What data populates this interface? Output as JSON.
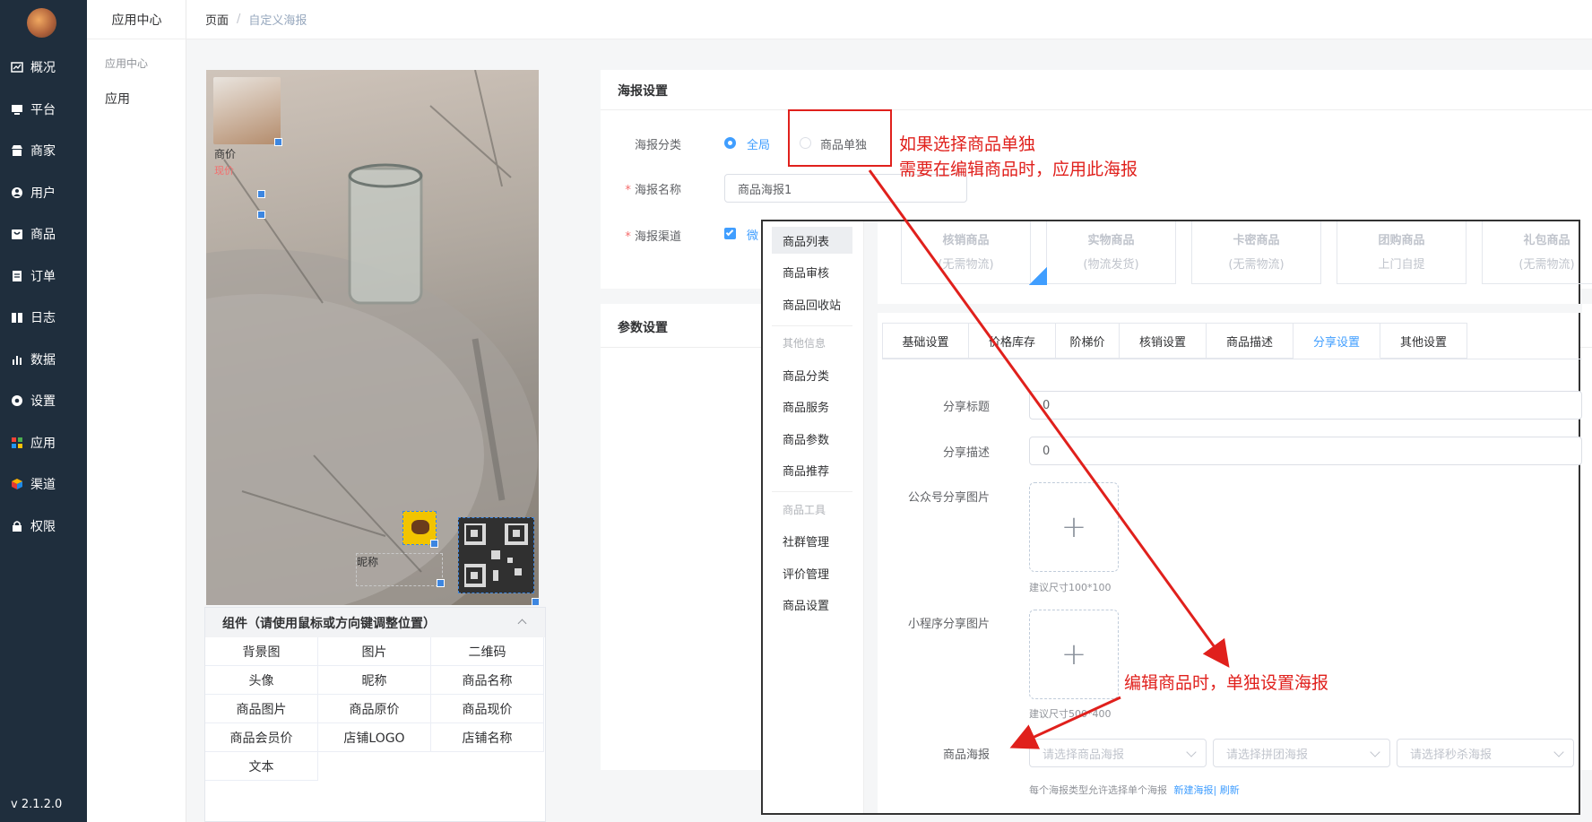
{
  "app": {
    "version": "v 2.1.2.0"
  },
  "sidebar": {
    "items": [
      {
        "label": "概况",
        "icon": "chart-icon"
      },
      {
        "label": "平台",
        "icon": "monitor-icon"
      },
      {
        "label": "商家",
        "icon": "store-icon"
      },
      {
        "label": "用户",
        "icon": "user-icon"
      },
      {
        "label": "商品",
        "icon": "goods-icon"
      },
      {
        "label": "订单",
        "icon": "order-icon"
      },
      {
        "label": "日志",
        "icon": "log-icon"
      },
      {
        "label": "数据",
        "icon": "bar-chart-icon"
      },
      {
        "label": "设置",
        "icon": "gear-icon"
      },
      {
        "label": "应用",
        "icon": "apps-icon"
      },
      {
        "label": "渠道",
        "icon": "cube-icon"
      },
      {
        "label": "权限",
        "icon": "lock-icon"
      }
    ]
  },
  "subsidebar": {
    "title": "应用中心",
    "group": "应用中心",
    "item": "应用"
  },
  "breadcrumb": {
    "root": "页面",
    "sep": "/",
    "current": "自定义海报"
  },
  "canvas": {
    "price_label": "商价",
    "vip_label": "现价",
    "nickname": "昵称"
  },
  "components": {
    "title": "组件（请使用鼠标或方向键调整位置）",
    "items": [
      "背景图",
      "图片",
      "二维码",
      "头像",
      "昵称",
      "商品名称",
      "商品图片",
      "商品原价",
      "商品现价",
      "商品会员价",
      "店铺LOGO",
      "店铺名称",
      "文本"
    ]
  },
  "poster": {
    "title": "海报设置",
    "category_label": "海报分类",
    "category_options": [
      "全局",
      "商品单独"
    ],
    "category_selected": "全局",
    "name_label": "海报名称",
    "name_value": "商品海报1",
    "channel_label": "海报渠道",
    "channel_text": "微"
  },
  "params": {
    "title": "参数设置"
  },
  "annotations": {
    "note1_line1": "如果选择商品单独",
    "note1_line2": "需要在编辑商品时，应用此海报",
    "note2": "编辑商品时，单独设置海报"
  },
  "goods_editor": {
    "menu": [
      {
        "label": "商品列表",
        "active": true
      },
      {
        "label": "商品审核"
      },
      {
        "label": "商品回收站"
      },
      {
        "label": "其他信息",
        "group": true
      },
      {
        "label": "商品分类"
      },
      {
        "label": "商品服务"
      },
      {
        "label": "商品参数"
      },
      {
        "label": "商品推荐"
      },
      {
        "label": "商品工具",
        "group": true
      },
      {
        "label": "社群管理"
      },
      {
        "label": "评价管理"
      },
      {
        "label": "商品设置"
      }
    ],
    "types": [
      {
        "name": "核销商品",
        "sub": "(无需物流)"
      },
      {
        "name": "实物商品",
        "sub": "(物流发货)"
      },
      {
        "name": "卡密商品",
        "sub": "(无需物流)"
      },
      {
        "name": "团购商品",
        "sub": "上门自提"
      },
      {
        "name": "礼包商品",
        "sub": "(无需物流)"
      }
    ],
    "tabs": [
      "基础设置",
      "价格库存",
      "阶梯价",
      "核销设置",
      "商品描述",
      "分享设置",
      "其他设置"
    ],
    "active_tab": "分享设置",
    "share_title_label": "分享标题",
    "share_title_value": "0",
    "share_desc_label": "分享描述",
    "share_desc_value": "0",
    "mp_img_label": "公众号分享图片",
    "mp_img_hint": "建议尺寸100*100",
    "mini_img_label": "小程序分享图片",
    "mini_img_hint": "建议尺寸500*400",
    "upload_symbol": "+",
    "poster_label": "商品海报",
    "poster_selects": [
      "请选择商品海报",
      "请选择拼团海报",
      "请选择秒杀海报"
    ],
    "poster_note": "每个海报类型允许选择单个海报",
    "new_poster": "新建海报",
    "refresh": "刷新"
  },
  "colors": {
    "sidebar_bg": "#1f2e3d",
    "primary": "#409eff",
    "annotation": "#e0201c"
  }
}
